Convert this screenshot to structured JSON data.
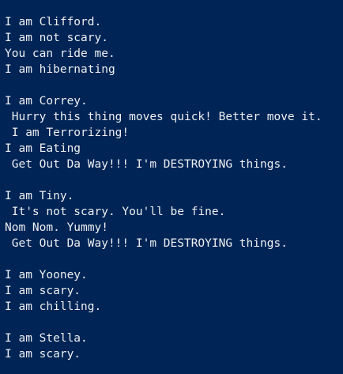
{
  "theme": {
    "background": "#012456",
    "foreground": "#ecf0f1"
  },
  "output": {
    "clifford": [
      "I am Clifford.",
      "I am not scary.",
      "You can ride me.",
      "I am hibernating"
    ],
    "correy": [
      "I am Correy.",
      " Hurry this thing moves quick! Better move it.",
      " I am Terrorizing!",
      "I am Eating",
      " Get Out Da Way!!! I'm DESTROYING things."
    ],
    "tiny": [
      "I am Tiny.",
      " It's not scary. You'll be fine.",
      "Nom Nom. Yummy!",
      " Get Out Da Way!!! I'm DESTROYING things."
    ],
    "yooney": [
      "I am Yooney.",
      "I am scary.",
      "I am chilling."
    ],
    "stella": [
      "I am Stella.",
      "I am scary."
    ]
  }
}
